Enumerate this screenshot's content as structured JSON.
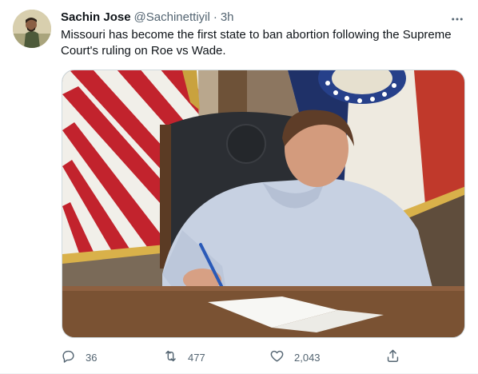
{
  "tweet": {
    "author_name": "Sachin Jose",
    "author_handle": "@Sachinettiyil",
    "separator": "·",
    "time": "3h",
    "text": "Missouri has become the first state to ban abortion following the Supreme Court's ruling on Roe vs Wade.",
    "more_icon": "more-horizontal-icon",
    "avatar_icon": "avatar"
  },
  "media": {
    "description_icon": "photo"
  },
  "actions": {
    "reply_count": "36",
    "retweet_count": "477",
    "like_count": "2,043",
    "reply_icon": "reply-icon",
    "retweet_icon": "retweet-icon",
    "like_icon": "heart-icon",
    "share_icon": "share-icon"
  },
  "colors": {
    "text_primary": "#0f1419",
    "text_secondary": "#536471",
    "border": "#cfd9de"
  }
}
